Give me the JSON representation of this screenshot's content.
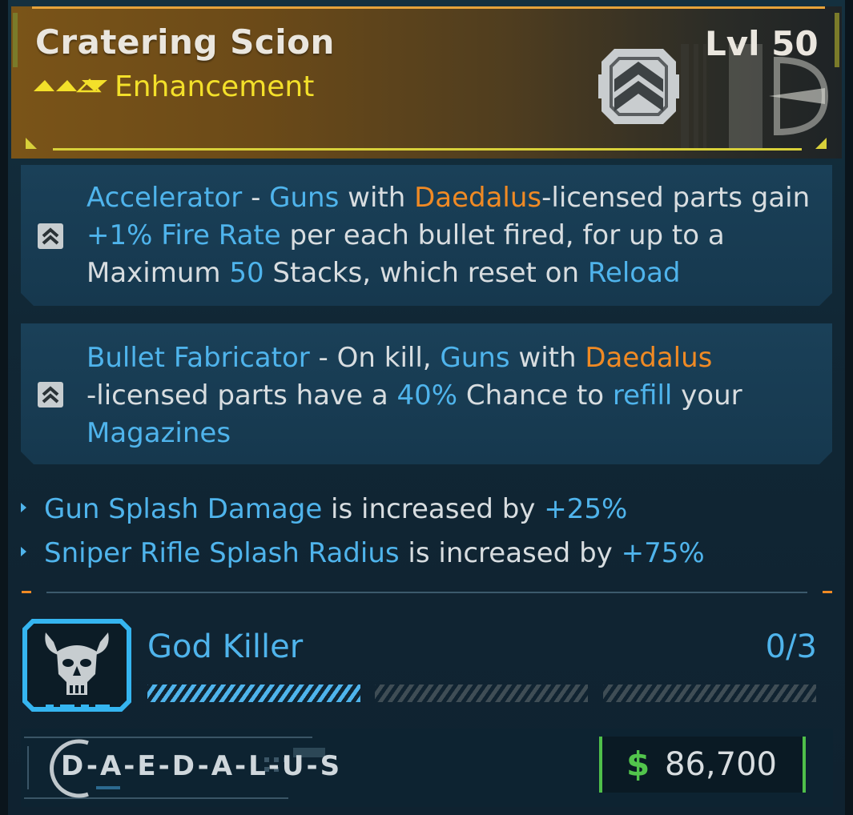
{
  "item": {
    "name": "Cratering Scion",
    "type": "Enhancement",
    "level": "Lvl 50",
    "rarity_icon": "rarity-chevrons-icon",
    "manufacturer_emblem": "daedalus-emblem-icon"
  },
  "perks": [
    {
      "icon": "chevron-up-perk-icon",
      "name": "Accelerator",
      "sep": " - ",
      "t1": "Guns",
      "t2": " with ",
      "t3": "Daedalus",
      "t4": "-licensed parts gain ",
      "t5": "+1% Fire Rate",
      "t6": " per each bullet fired, for up to a Maximum ",
      "t7": "50",
      "t8": " Stacks, which reset on ",
      "t9": "Reload"
    },
    {
      "icon": "chevron-up-perk-icon",
      "name": "Bullet Fabricator",
      "sep": " - On kill, ",
      "t1": "Guns",
      "t2": " with ",
      "t3": "Daedalus",
      "t4": " -licensed parts have a ",
      "t5": "40%",
      "t6": " Chance to ",
      "t7": "refill",
      "t8": " your ",
      "t9": "Magazines"
    }
  ],
  "stats": [
    {
      "name": "Gun Splash Damage",
      "mid": " is increased by ",
      "value": "+25%"
    },
    {
      "name": "Sniper Rifle Splash Radius",
      "mid": " is increased by ",
      "value": "+75%"
    }
  ],
  "challenge": {
    "icon": "god-killer-skull-icon",
    "name": "God Killer",
    "progress_text": "0/3",
    "segments": 3,
    "segments_filled": 1
  },
  "footer": {
    "manufacturer": "D-A-E-D-A-L-U-S",
    "currency_symbol": "$",
    "price": "86,700"
  },
  "colors": {
    "highlight_blue": "#4fb4ec",
    "highlight_orange": "#f08a24",
    "type_yellow": "#f3e02a",
    "price_green": "#52c44c"
  }
}
